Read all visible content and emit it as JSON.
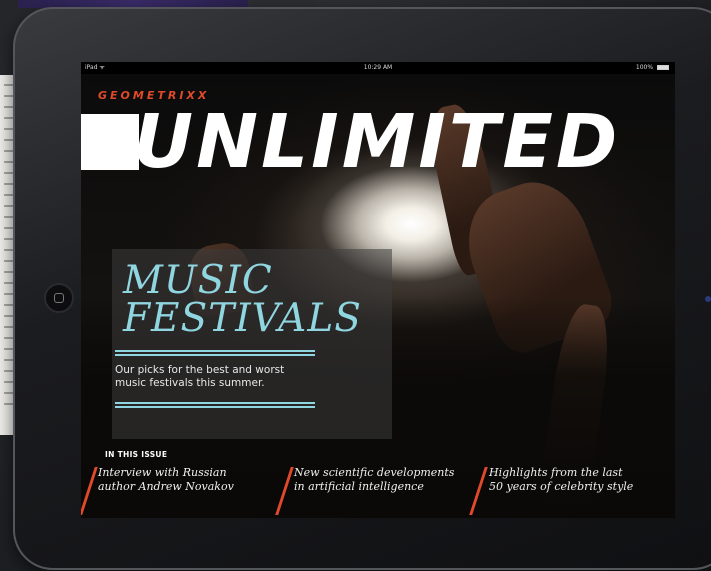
{
  "statusbar": {
    "carrier": "iPad ᯤ",
    "time": "10:29 AM",
    "battery": "100%"
  },
  "magazine": {
    "brand": "GEOMETRIXX",
    "masthead": "UNLIMITED",
    "feature": {
      "title_line1": "MUSIC",
      "title_line2": "FESTIVALS",
      "description": "Our picks for the best and worst music festivals this summer."
    },
    "in_this_issue": {
      "heading": "IN THIS ISSUE",
      "items": [
        {
          "line1": "Interview with Russian",
          "line2": "author Andrew Novakov"
        },
        {
          "line1": "New scientific developments",
          "line2": "in artificial intelligence"
        },
        {
          "line1": "Highlights from the last",
          "line2": "50 years of celebrity style"
        }
      ]
    }
  },
  "colors": {
    "accent": "#e04a2a",
    "feature_cyan": "#8fd6e0",
    "device": "#1b1c1f"
  }
}
